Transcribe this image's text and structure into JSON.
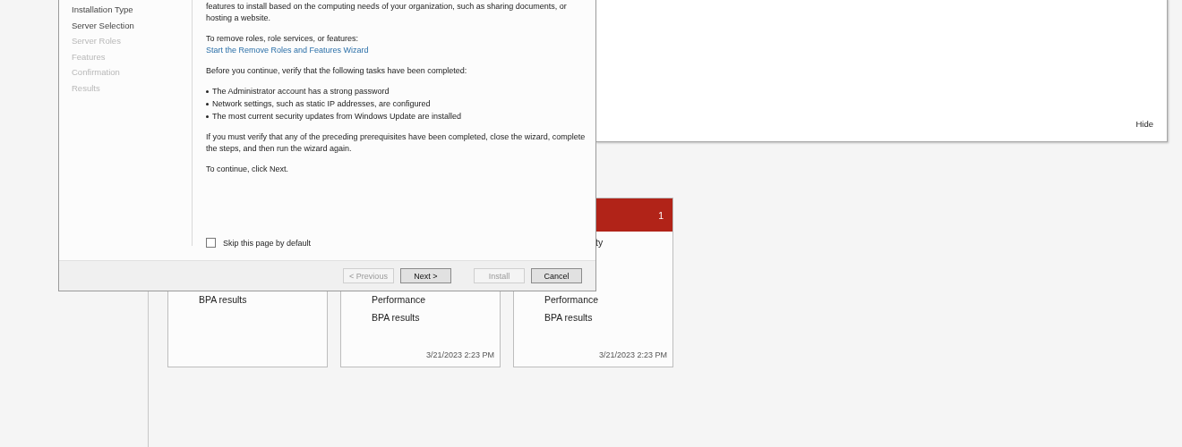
{
  "welcome_panel": {
    "hide_link": "Hide"
  },
  "tiles": [
    {
      "lines": [
        "BPA results"
      ]
    },
    {
      "lines": [
        "Performance",
        "BPA results"
      ],
      "timestamp": "3/21/2023 2:23 PM"
    },
    {
      "alert": true,
      "count": "1",
      "partial_line": "ty",
      "lines": [
        "Performance",
        "BPA results"
      ],
      "timestamp": "3/21/2023 2:23 PM"
    }
  ],
  "wizard": {
    "steps": [
      {
        "label": "Installation Type",
        "disabled": false
      },
      {
        "label": "Server Selection",
        "disabled": false
      },
      {
        "label": "Server Roles",
        "disabled": true
      },
      {
        "label": "Features",
        "disabled": true
      },
      {
        "label": "Confirmation",
        "disabled": true
      },
      {
        "label": "Results",
        "disabled": true
      }
    ],
    "intro": "features to install based on the computing needs of your organization, such as sharing documents, or hosting a website.",
    "remove_text": "To remove roles, role services, or features:",
    "remove_link": "Start the Remove Roles and Features Wizard",
    "verify_text": "Before you continue, verify that the following tasks have been completed:",
    "tasks": [
      "The Administrator account has a strong password",
      "Network settings, such as static IP addresses, are configured",
      "The most current security updates from Windows Update are installed"
    ],
    "verify_note": "If you must verify that any of the preceding prerequisites have been completed, close the wizard, complete the steps, and then run the wizard again.",
    "continue_text": "To continue, click Next.",
    "skip_checkbox": {
      "label": "Skip this page by default",
      "checked": false
    },
    "buttons": [
      {
        "label": "< Previous",
        "disabled": true
      },
      {
        "label": "Next >",
        "disabled": false
      },
      {
        "label": "Install",
        "disabled": true
      },
      {
        "label": "Cancel",
        "disabled": false
      }
    ]
  }
}
